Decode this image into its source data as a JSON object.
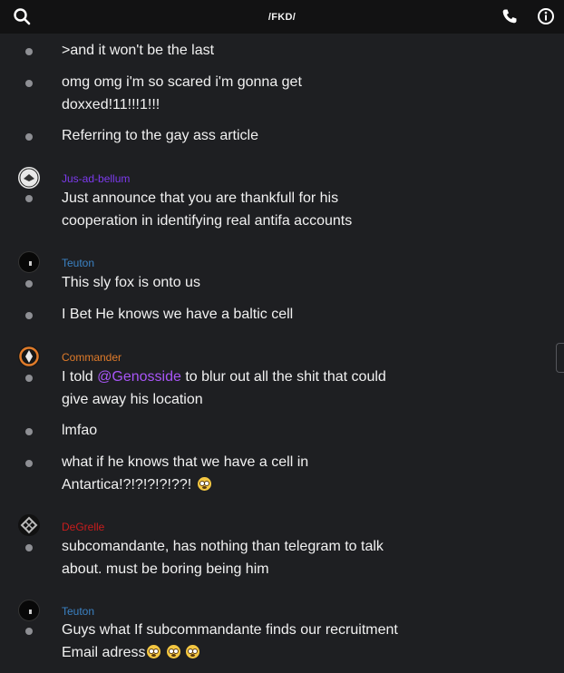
{
  "header": {
    "title": "/FKD/",
    "icons": [
      "search-icon",
      "phone-icon",
      "info-icon"
    ]
  },
  "colors": {
    "background": "#1e1f22",
    "topbar": "#121213",
    "jus_ad_bellum": "#7c3aed",
    "teuton": "#3b82c4",
    "commander": "#e07b2a",
    "degrelle": "#c81d1d",
    "mention": "#a855f7"
  },
  "messages": {
    "m1": ">and it won't be the last",
    "m2": "omg omg i'm so scared i'm gonna get doxxed!11!!!1!!!",
    "m3": "Referring to the gay ass article",
    "m4": "Just announce that you are thankfull for his cooperation in identifying real antifa accounts",
    "m5": "This sly fox is onto us",
    "m6": "I Bet He knows we have a baltic cell",
    "m7_pre": "I told ",
    "m7_mention": "@Genosside",
    "m7_post": " to blur out all the shit that could give away his location",
    "m8": "lmfao",
    "m9": "what if he knows that we have a cell in Antartica!?!?!?!?!??! ",
    "m10": "subcomandante, has nothing than telegram to talk about. must be boring being him",
    "m11": "Guys what If subcommandante finds our recruitment Email adress"
  },
  "authors": {
    "a1": "Jus-ad-bellum",
    "a2": "Teuton",
    "a3": "Commander",
    "a4": "DeGrelle",
    "a5": "Teuton"
  }
}
